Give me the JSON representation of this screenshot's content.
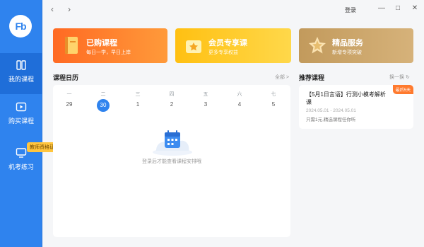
{
  "app": {
    "logo_text": "Fb"
  },
  "sidebar": {
    "items": [
      {
        "label": "我的课程",
        "icon": "book-icon"
      },
      {
        "label": "购买课程",
        "icon": "play-icon"
      },
      {
        "label": "机考练习",
        "icon": "computer-icon"
      }
    ],
    "badge": "教师资格证"
  },
  "topbar": {
    "login": "登录"
  },
  "banners": [
    {
      "title": "已购课程",
      "subtitle": "每日一学，早日上岸",
      "icon": "book-icon",
      "color": "#ff7a2b"
    },
    {
      "title": "会员专享课",
      "subtitle": "更多专享权益",
      "icon": "crown-icon",
      "color": "#ffc414"
    },
    {
      "title": "精品服务",
      "subtitle": "新增专项突破",
      "icon": "star-icon",
      "color": "#c9a165"
    }
  ],
  "calendar": {
    "title": "课程日历",
    "all_link": "全部 >",
    "weekdays": [
      "一",
      "二",
      "三",
      "四",
      "五",
      "六",
      "七"
    ],
    "days": [
      "29",
      "30",
      "1",
      "2",
      "3",
      "4",
      "5"
    ],
    "today_index": 1,
    "empty_text": "登录后才能查看课程安排哦"
  },
  "recommend": {
    "title": "推荐课程",
    "refresh_link": "换一换",
    "course": {
      "title": "【5月1日言语】行测小模考解析课",
      "date": "2024.05.01 - 2024.05.01",
      "desc": "只需1元,精选课程任你听",
      "tag": "最后5天"
    }
  }
}
